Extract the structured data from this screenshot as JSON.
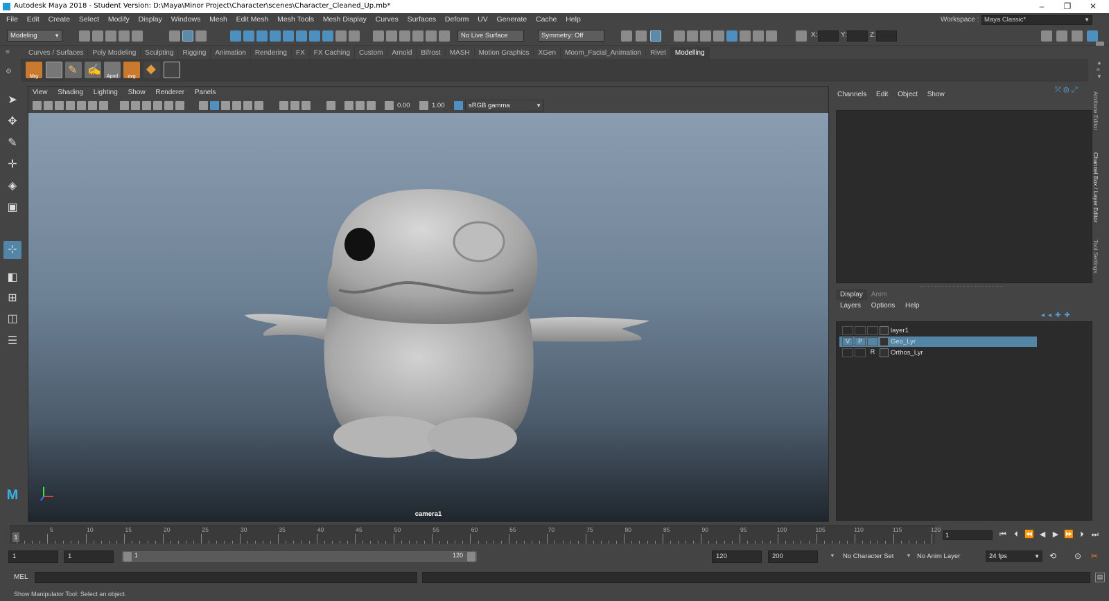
{
  "window": {
    "title": "Autodesk Maya 2018 - Student Version: D:\\Maya\\Minor Project\\Character\\scenes\\Character_Cleaned_Up.mb*",
    "minimize": "–",
    "maximize": "❐",
    "close": "✕"
  },
  "menubar": {
    "items": [
      "File",
      "Edit",
      "Create",
      "Select",
      "Modify",
      "Display",
      "Windows",
      "Mesh",
      "Edit Mesh",
      "Mesh Tools",
      "Mesh Display",
      "Curves",
      "Surfaces",
      "Deform",
      "UV",
      "Generate",
      "Cache",
      "Help"
    ],
    "workspace_label": "Workspace :",
    "workspace_value": "Maya Classic*"
  },
  "statusline": {
    "menuset": "Modeling",
    "live_surface": "No Live Surface",
    "symmetry": "Symmetry: Off",
    "x_label": "X:",
    "y_label": "Y:",
    "z_label": "Z:"
  },
  "shelf": {
    "tabs": [
      "Curves / Surfaces",
      "Poly Modeling",
      "Sculpting",
      "Rigging",
      "Animation",
      "Rendering",
      "FX",
      "FX Caching",
      "Custom",
      "Arnold",
      "Bifrost",
      "MASH",
      "Motion Graphics",
      "XGen",
      "Moom_Facial_Animation",
      "Rivet",
      "Modelling"
    ],
    "active_tab": "Modelling",
    "icons": [
      {
        "icon": "merge-icon",
        "caption": "Mrg"
      },
      {
        "icon": "grid-icon",
        "caption": ""
      },
      {
        "icon": "pencil-icon",
        "caption": ""
      },
      {
        "icon": "brush-icon",
        "caption": ""
      },
      {
        "icon": "append-icon",
        "caption": "Apnd"
      },
      {
        "icon": "average-icon",
        "caption": "avg"
      },
      {
        "icon": "diamond-icon",
        "caption": ""
      },
      {
        "icon": "crosshair-box-icon",
        "caption": ""
      }
    ]
  },
  "viewport": {
    "menu": [
      "View",
      "Shading",
      "Lighting",
      "Show",
      "Renderer",
      "Panels"
    ],
    "exposure": "0.00",
    "gamma": "1.00",
    "color_space": "sRGB gamma",
    "camera_label": "camera1"
  },
  "channel_box": {
    "menu": [
      "Channels",
      "Edit",
      "Object",
      "Show"
    ]
  },
  "layer_editor": {
    "tabs": [
      "Display",
      "Anim"
    ],
    "active_tab": "Display",
    "menu": [
      "Layers",
      "Options",
      "Help"
    ],
    "layers": [
      {
        "name": "layer1",
        "v": "",
        "p": "",
        "r": "",
        "selected": false
      },
      {
        "name": "Geo_Lyr",
        "v": "V",
        "p": "P",
        "r": "",
        "selected": true
      },
      {
        "name": "Orthos_Lyr",
        "v": "",
        "p": "",
        "r": "R",
        "selected": false
      }
    ]
  },
  "side_tabs": [
    "Attribute Editor",
    "Channel Box / Layer Editor",
    "Tool Settings"
  ],
  "timeslider": {
    "labels": [
      "5",
      "10",
      "15",
      "20",
      "25",
      "30",
      "35",
      "40",
      "45",
      "50",
      "55",
      "60",
      "65",
      "70",
      "75",
      "80",
      "85",
      "90",
      "95",
      "100",
      "105",
      "110",
      "115",
      "120"
    ],
    "current_frame_marker": "1",
    "current_frame_field": "1"
  },
  "rangeslider": {
    "start_time": "1",
    "playback_start": "1",
    "range_start": "1",
    "range_end": "120",
    "playback_end": "120",
    "end_time": "200",
    "character_set": "No Character Set",
    "anim_layer": "No Anim Layer",
    "fps": "24 fps"
  },
  "cmdline": {
    "label": "MEL"
  },
  "helpline": {
    "text": "Show Manipulator Tool: Select an object."
  },
  "colors": {
    "ui_bg": "#444444",
    "field_bg": "#2b2b2b",
    "highlight": "#5285a6",
    "maya_logo": "#1e9bd7"
  }
}
